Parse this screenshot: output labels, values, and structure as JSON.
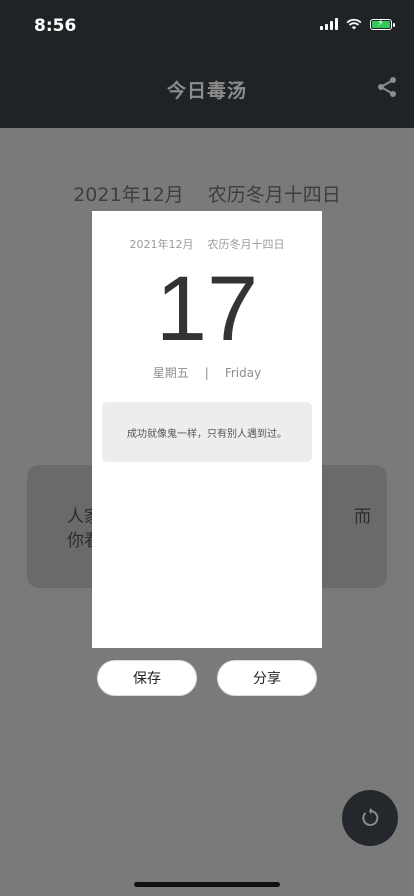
{
  "status": {
    "time": "8:56"
  },
  "header": {
    "title": "今日毒汤"
  },
  "background": {
    "month": "2021年12月",
    "lunar": "农历冬月十四日",
    "quote_start": "人家",
    "quote_line2": "你看",
    "quote_tail": "而"
  },
  "modal": {
    "month": "2021年12月",
    "lunar": "农历冬月十四日",
    "day": "17",
    "weekday_cn": "星期五",
    "separator": "|",
    "weekday_en": "Friday",
    "quote": "成功就像鬼一样，只有别人遇到过。"
  },
  "buttons": {
    "save": "保存",
    "share": "分享"
  },
  "colors": {
    "nav_bg": "#202326",
    "overlay": "#7a7a7a",
    "battery": "#34c759"
  },
  "icons": {
    "share": "share-icon",
    "refresh": "refresh-icon"
  }
}
